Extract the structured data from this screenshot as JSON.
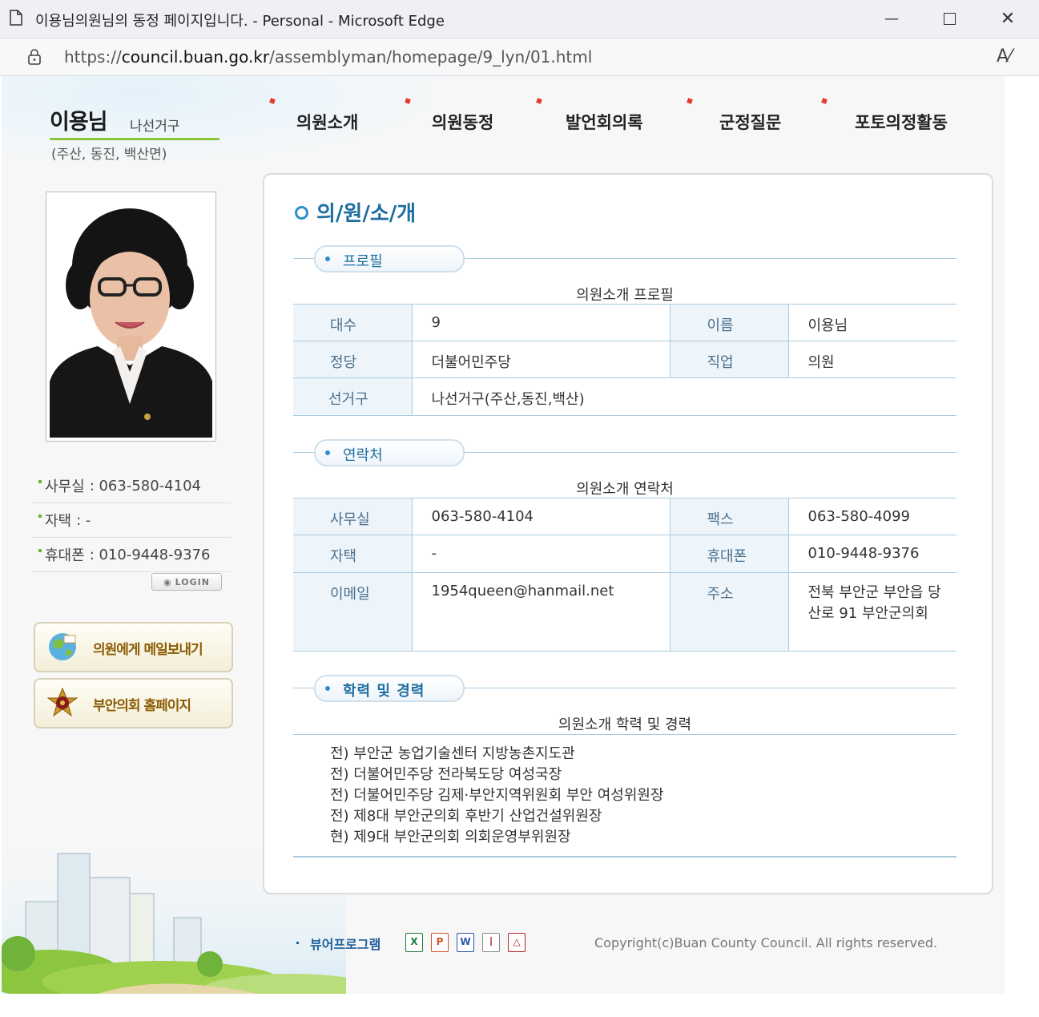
{
  "browser": {
    "title": "이용님의원님의 동정 페이지입니다. - Personal - Microsoft Edge",
    "url_prefix": "https://",
    "url_domain": "council.buan.go.kr",
    "url_path": "/assemblyman/homepage/9_lyn/01.html"
  },
  "member": {
    "name": "이용님",
    "district": "나선거구",
    "area": "(주산, 동진, 백산면)"
  },
  "nav": [
    "의원소개",
    "의원동정",
    "발언회의록",
    "군정질문",
    "포토의정활동"
  ],
  "sidebar": {
    "contacts": [
      {
        "label": "사무실",
        "value": ": 063-580-4104"
      },
      {
        "label": "자택",
        "value": ": -"
      },
      {
        "label": "휴대폰",
        "value": ": 010-9448-9376"
      }
    ],
    "login_label": "LOGIN",
    "mail_button": "의원에게 메일보내기",
    "home_button": "부안의회 홈페이지"
  },
  "main": {
    "title": "의/원/소/개",
    "profile": {
      "section": "프로필",
      "caption": "의원소개 프로필",
      "rows": [
        {
          "l1": "대수",
          "v1": "9",
          "l2": "이름",
          "v2": "이용님"
        },
        {
          "l1": "정당",
          "v1": "더불어민주당",
          "l2": "직업",
          "v2": "의원"
        }
      ],
      "district_label": "선거구",
      "district_value": "나선거구(주산,동진,백산)"
    },
    "contact": {
      "section": "연락처",
      "caption": "의원소개 연락처",
      "rows": [
        {
          "l1": "사무실",
          "v1": "063-580-4104",
          "l2": "팩스",
          "v2": "063-580-4099"
        },
        {
          "l1": "자택",
          "v1": "-",
          "l2": "휴대폰",
          "v2": "010-9448-9376"
        },
        {
          "l1": "이메일",
          "v1": "1954queen@hanmail.net",
          "l2": "주소",
          "v2": "전북 부안군 부안읍 당산로 91 부안군의회"
        }
      ]
    },
    "career": {
      "section": "학력 및 경력",
      "caption": "의원소개 학력 및 경력",
      "items": [
        "전) 부안군 농업기술센터 지방농촌지도관",
        "전) 더불어민주당 전라북도당 여성국장",
        "전) 더불어민주당 김제·부안지역위원회 부안 여성위원장",
        "전) 제8대 부안군의회 후반기 산업건설위원장",
        "현) 제9대 부안군의회 의회운영부위원장"
      ]
    }
  },
  "footer": {
    "viewer_label": "뷰어프로그램",
    "copyright": "Copyright(c)Buan County Council. All rights reserved."
  }
}
